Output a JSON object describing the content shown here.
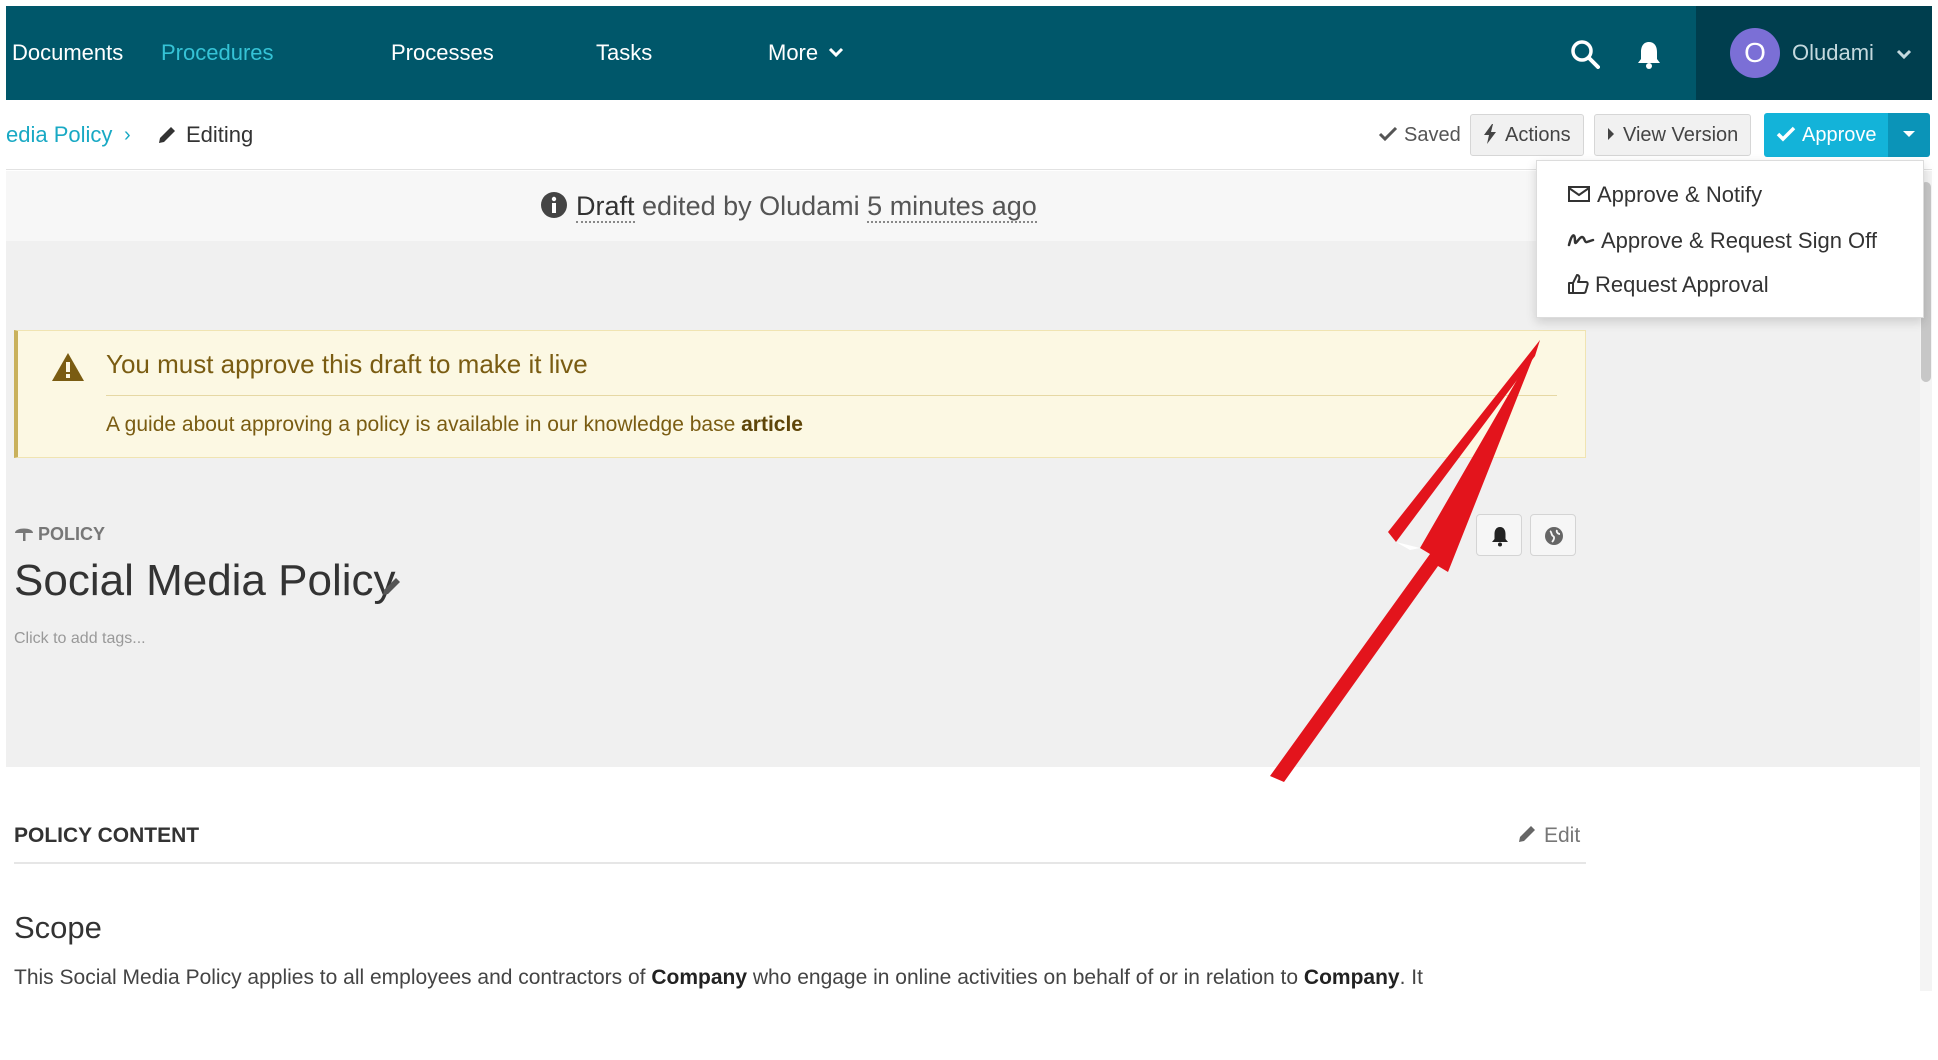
{
  "topnav": {
    "items": [
      {
        "label": "Documents",
        "active": false
      },
      {
        "label": "Procedures",
        "active": true
      },
      {
        "label": "Processes",
        "active": false
      },
      {
        "label": "Tasks",
        "active": false
      },
      {
        "label": "More",
        "active": false
      }
    ],
    "search_icon": "search-icon",
    "notification_icon": "bell-icon",
    "user": {
      "initial": "O",
      "name": "Oludami"
    }
  },
  "breadcrumb": {
    "parent": "edia Policy",
    "separator": "›",
    "current": "Editing"
  },
  "toolbar": {
    "saved_label": "Saved",
    "actions_label": "Actions",
    "view_version_label": "View Version",
    "approve_label": "Approve"
  },
  "approve_menu": {
    "items": [
      {
        "label": "Approve & Notify",
        "icon": "envelope-icon"
      },
      {
        "label": "Approve & Request Sign Off",
        "icon": "signature-icon"
      },
      {
        "label": "Request Approval",
        "icon": "thumbs-up-icon"
      }
    ]
  },
  "draft_bar": {
    "status": "Draft",
    "edited_by": "edited by Oludami",
    "when": "5 minutes ago"
  },
  "alert": {
    "title": "You must approve this draft to make it live",
    "text": "A guide about approving a policy is available in our knowledge base",
    "link": "article"
  },
  "policy": {
    "type_label": "POLICY",
    "title": "Social Media Policy",
    "tags_hint": "Click to add tags..."
  },
  "content": {
    "heading": "POLICY CONTENT",
    "edit_label": "Edit",
    "scope_title": "Scope",
    "scope_text": {
      "p1": "This Social Media Policy applies to all employees and contractors of",
      "b1": "Company",
      "p2": "who engage in online activities on behalf of or in relation to",
      "b2": "Company",
      "p3": ". It"
    }
  },
  "colors": {
    "nav_bg": "#00576a",
    "nav_active": "#35c3d6",
    "user_area_bg": "#003e4e",
    "avatar": "#7b6fd6",
    "approve": "#13b3d9",
    "alert_bg": "#fcf8e3",
    "annotation_arrow": "#e3141c"
  }
}
